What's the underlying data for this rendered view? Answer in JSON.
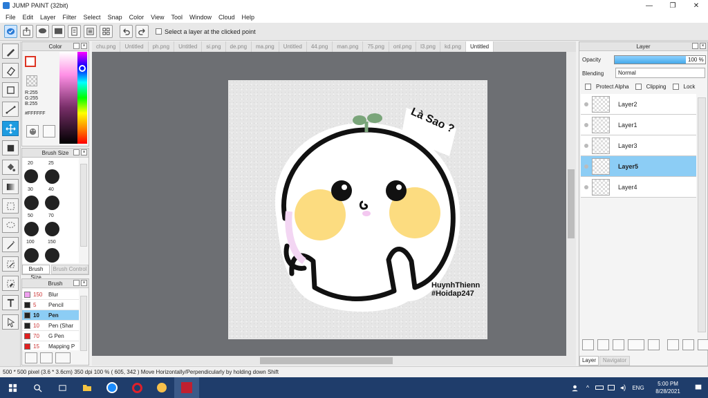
{
  "window": {
    "title": "JUMP PAINT (32bit)",
    "minimize": "—",
    "maximize": "❐",
    "close": "✕"
  },
  "menu": [
    "File",
    "Edit",
    "Layer",
    "Filter",
    "Select",
    "Snap",
    "Color",
    "View",
    "Tool",
    "Window",
    "Cloud",
    "Help"
  ],
  "toolbar": {
    "select_layer_label": "Select a layer at the clicked point",
    "select_layer_checked": false
  },
  "color_panel": {
    "title": "Color",
    "r": "R:255",
    "g": "G:255",
    "b": "B:255",
    "hex": "#FFFFFF"
  },
  "brush_size_panel": {
    "title": "Brush Size",
    "sizes": [
      "20",
      "25",
      "30",
      "40",
      "50",
      "70",
      "100",
      "150"
    ],
    "tabs": [
      "Brush Size",
      "Brush Control"
    ]
  },
  "brush_panel": {
    "title": "Brush",
    "items": [
      {
        "size": "150",
        "name": "Blur",
        "color": "#f0a0f0"
      },
      {
        "size": "5",
        "name": "Pencil",
        "color": "#222222"
      },
      {
        "size": "10",
        "name": "Pen",
        "color": "#222222",
        "selected": true
      },
      {
        "size": "10",
        "name": "Pen (Shar",
        "color": "#222222"
      },
      {
        "size": "70",
        "name": "G Pen",
        "color": "#e02020"
      },
      {
        "size": "15",
        "name": "Mapping P",
        "color": "#e02020"
      }
    ]
  },
  "tabs": [
    "chu.png",
    "Untitled",
    "ph.png",
    "Untitled",
    "si.png",
    "de.png",
    "ma.png",
    "Untitled",
    "44.png",
    "man.png",
    "75.png",
    "onl.png",
    "l3.png",
    "kd.png",
    "Untitled"
  ],
  "active_tab_index": 14,
  "artwork": {
    "speech": "Là Sao ?",
    "credit_line1": "HuynhThienn",
    "credit_line2": "#Hoidap247"
  },
  "layer_panel": {
    "title": "Layer",
    "opacity_label": "Opacity",
    "opacity_value": "100 %",
    "blending_label": "Blending",
    "blending_value": "Normal",
    "protect_alpha": "Protect Alpha",
    "clipping": "Clipping",
    "lock": "Lock",
    "layers": [
      {
        "name": "Layer2"
      },
      {
        "name": "Layer1"
      },
      {
        "name": "Layer3"
      },
      {
        "name": "Layer5",
        "selected": true
      },
      {
        "name": "Layer4"
      }
    ],
    "bottom_tabs": [
      "Layer",
      "Navigator"
    ]
  },
  "status": {
    "size": "500 * 500 pixel",
    "physical": "(3.6 * 3.6cm)",
    "dpi": "350 dpi",
    "zoom": "100 %",
    "coords": "( 605, 342 )",
    "hint": "Move Horizontally/Perpendicularly by holding down Shift"
  },
  "taskbar": {
    "lang": "ENG",
    "time": "5:00 PM",
    "date": "8/28/2021"
  }
}
